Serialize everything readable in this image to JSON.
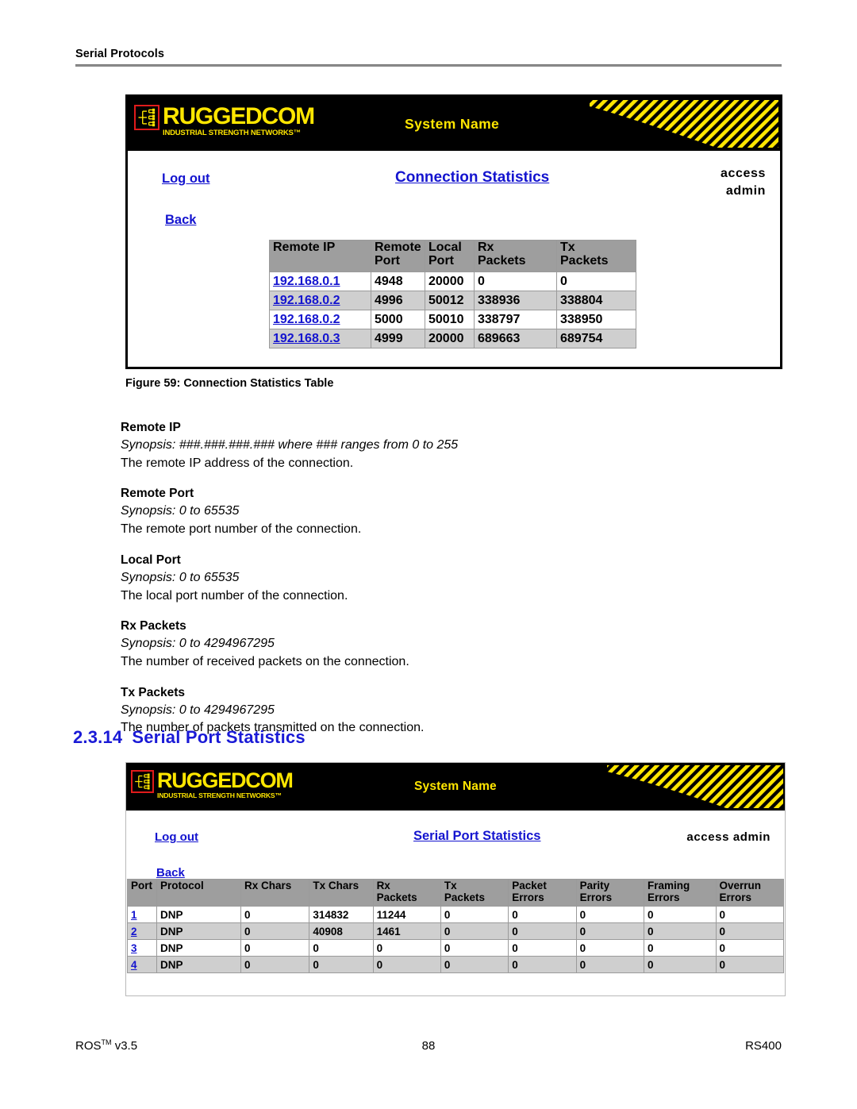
{
  "page": {
    "running_head": "Serial Protocols",
    "footer": {
      "product": "ROS",
      "trademark": "TM",
      "version": "v3.5",
      "page_number": "88",
      "model": "RS400"
    }
  },
  "figure": {
    "caption": "Figure 59: Connection Statistics Table"
  },
  "section": {
    "number": "2.3.14",
    "title": "Serial Port Statistics"
  },
  "brand": {
    "name": "RUGGEDCOM",
    "tagline": "INDUSTRIAL STRENGTH NETWORKS™",
    "yellow": "#ffe600",
    "red": "#e01b1b",
    "link_blue": "#1414cf",
    "header_gray": "#9e9e9e",
    "row_alt_gray": "#cfcfcf"
  },
  "screenshot1": {
    "system_name": "System Name",
    "logout_label": "Log out",
    "back_label": "Back",
    "page_title": "Connection Statistics",
    "access_line1": "access",
    "access_line2": "admin",
    "table": {
      "columns": [
        "Remote IP",
        "Remote Port",
        "Local Port",
        "Rx Packets",
        "Tx Packets"
      ],
      "columns_split": [
        {
          "l1": "Remote IP",
          "l2": ""
        },
        {
          "l1": "Remote",
          "l2": "Port"
        },
        {
          "l1": "Local",
          "l2": "Port"
        },
        {
          "l1": "Rx",
          "l2": "Packets"
        },
        {
          "l1": "Tx",
          "l2": "Packets"
        }
      ],
      "rows": [
        {
          "remote_ip": "192.168.0.1",
          "remote_port": "4948",
          "local_port": "20000",
          "rx_packets": "0",
          "tx_packets": "0"
        },
        {
          "remote_ip": "192.168.0.2",
          "remote_port": "4996",
          "local_port": "50012",
          "rx_packets": "338936",
          "tx_packets": "338804"
        },
        {
          "remote_ip": "192.168.0.2",
          "remote_port": "5000",
          "local_port": "50010",
          "rx_packets": "338797",
          "tx_packets": "338950"
        },
        {
          "remote_ip": "192.168.0.3",
          "remote_port": "4999",
          "local_port": "20000",
          "rx_packets": "689663",
          "tx_packets": "689754"
        }
      ]
    }
  },
  "screenshot2": {
    "system_name": "System Name",
    "logout_label": "Log out",
    "back_label": "Back",
    "page_title": "Serial Port Statistics",
    "access_text": "access admin",
    "table": {
      "columns_split": [
        {
          "l1": "Port",
          "l2": ""
        },
        {
          "l1": "Protocol",
          "l2": ""
        },
        {
          "l1": "Rx Chars",
          "l2": ""
        },
        {
          "l1": "Tx Chars",
          "l2": ""
        },
        {
          "l1": "Rx",
          "l2": "Packets"
        },
        {
          "l1": "Tx",
          "l2": "Packets"
        },
        {
          "l1": "Packet",
          "l2": "Errors"
        },
        {
          "l1": "Parity",
          "l2": "Errors"
        },
        {
          "l1": "Framing",
          "l2": "Errors"
        },
        {
          "l1": "Overrun",
          "l2": "Errors"
        }
      ],
      "rows": [
        {
          "port": "1",
          "protocol": "DNP",
          "rx_chars": "0",
          "tx_chars": "314832",
          "rx_packets": "11244",
          "tx_packets": "0",
          "packet_errors": "0",
          "parity_errors": "0",
          "framing_errors": "0",
          "overrun_errors": "0"
        },
        {
          "port": "2",
          "protocol": "DNP",
          "rx_chars": "0",
          "tx_chars": "40908",
          "rx_packets": "1461",
          "tx_packets": "0",
          "packet_errors": "0",
          "parity_errors": "0",
          "framing_errors": "0",
          "overrun_errors": "0"
        },
        {
          "port": "3",
          "protocol": "DNP",
          "rx_chars": "0",
          "tx_chars": "0",
          "rx_packets": "0",
          "tx_packets": "0",
          "packet_errors": "0",
          "parity_errors": "0",
          "framing_errors": "0",
          "overrun_errors": "0"
        },
        {
          "port": "4",
          "protocol": "DNP",
          "rx_chars": "0",
          "tx_chars": "0",
          "rx_packets": "0",
          "tx_packets": "0",
          "packet_errors": "0",
          "parity_errors": "0",
          "framing_errors": "0",
          "overrun_errors": "0"
        }
      ]
    }
  },
  "definitions": [
    {
      "term": "Remote IP",
      "synopsis": "Synopsis: ###.###.###.###  where ### ranges from 0 to 255",
      "description": "The remote IP address of the connection."
    },
    {
      "term": "Remote Port",
      "synopsis": "Synopsis: 0 to 65535",
      "description": "The remote port number of the connection."
    },
    {
      "term": "Local Port",
      "synopsis": "Synopsis: 0 to 65535",
      "description": "The local port number of the connection."
    },
    {
      "term": "Rx Packets",
      "synopsis": "Synopsis: 0 to 4294967295",
      "description": "The number of received packets on the connection."
    },
    {
      "term": "Tx Packets",
      "synopsis": "Synopsis: 0 to 4294967295",
      "description": "The number of packets transmitted on the connection."
    }
  ]
}
